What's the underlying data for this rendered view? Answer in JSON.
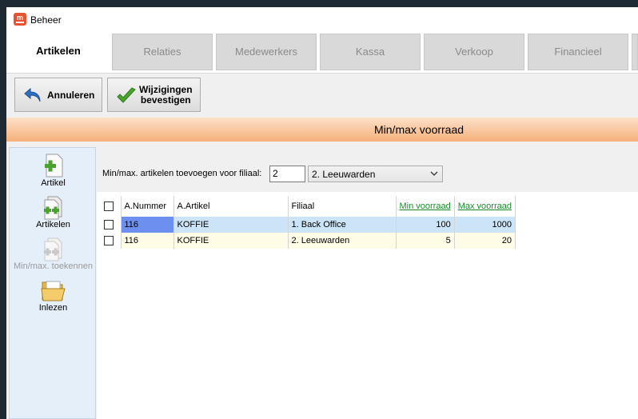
{
  "window": {
    "title": "Beheer"
  },
  "tabs": [
    {
      "label": "Artikelen"
    },
    {
      "label": "Relaties"
    },
    {
      "label": "Medewerkers"
    },
    {
      "label": "Kassa"
    },
    {
      "label": "Verkoop"
    },
    {
      "label": "Financieel"
    }
  ],
  "toolbar": {
    "cancel_label": "Annuleren",
    "confirm_label_line1": "Wijzigingen",
    "confirm_label_line2": "bevestigen"
  },
  "section": {
    "title": "Min/max voorraad"
  },
  "sidebar": {
    "items": [
      {
        "label": "Artikel",
        "icon": "add-document-icon"
      },
      {
        "label": "Artikelen",
        "icon": "add-documents-icon"
      },
      {
        "label": "Min/max. toekennen",
        "icon": "assign-documents-icon"
      },
      {
        "label": "Inlezen",
        "icon": "open-folder-icon"
      }
    ]
  },
  "filter": {
    "label": "Min/max. artikelen toevoegen voor filiaal:",
    "filial_number": "2",
    "filial_selected": "2. Leeuwarden"
  },
  "grid": {
    "columns": {
      "nummer": "A.Nummer",
      "artikel": "A.Artikel",
      "filiaal": "Filiaal",
      "min": "Min voorraad",
      "max": "Max voorraad"
    },
    "rows": [
      {
        "nummer": "116",
        "artikel": "KOFFIE",
        "filiaal": "1. Back Office",
        "min": "100",
        "max": "1000"
      },
      {
        "nummer": "116",
        "artikel": "KOFFIE",
        "filiaal": "2. Leeuwarden",
        "min": "5",
        "max": "20"
      }
    ]
  },
  "colors": {
    "accent_orange": "#f5b07a",
    "selected_row": "#cce4f7",
    "selected_cell": "#6c8ff0",
    "sortable_header": "#1a8a2a"
  }
}
